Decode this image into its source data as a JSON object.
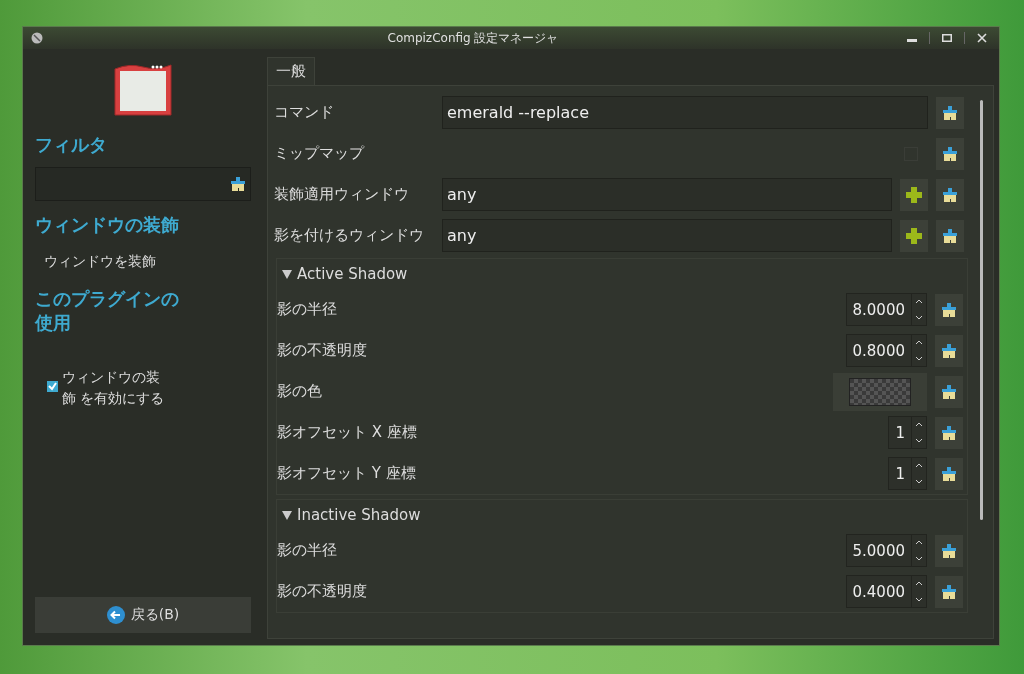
{
  "window": {
    "title": "CompizConfig 設定マネージャ"
  },
  "sidebar": {
    "filter_heading": "フィルタ",
    "plugin_heading": "ウィンドウの装飾",
    "plugin_description": "ウィンドウを装飾",
    "usage_heading": "このプラグインの使用",
    "enable": {
      "label": "ウィンドウの装飾 を有効にする",
      "checked": true
    },
    "back_button": "戻る(B)"
  },
  "tabs": [
    {
      "label": "一般",
      "selected": true
    }
  ],
  "options": [
    {
      "kind": "entry",
      "label": "コマンド",
      "value": "emerald --replace"
    },
    {
      "kind": "check",
      "label": "ミップマップ",
      "checked": false
    },
    {
      "kind": "list",
      "label": "装飾適用ウィンドウ",
      "value": "any"
    },
    {
      "kind": "list",
      "label": "影を付けるウィンドウ",
      "value": "any"
    },
    {
      "kind": "section",
      "label": "Active Shadow",
      "expanded": true,
      "children": [
        {
          "kind": "spin",
          "label": "影の半径",
          "value": "8.0000"
        },
        {
          "kind": "spin",
          "label": "影の不透明度",
          "value": "0.8000"
        },
        {
          "kind": "color",
          "label": "影の色"
        },
        {
          "kind": "spin",
          "label": "影オフセット X 座標",
          "value": "1"
        },
        {
          "kind": "spin",
          "label": "影オフセット Y 座標",
          "value": "1"
        }
      ]
    },
    {
      "kind": "section",
      "label": "Inactive Shadow",
      "expanded": true,
      "children": [
        {
          "kind": "spin",
          "label": "影の半径",
          "value": "5.0000"
        },
        {
          "kind": "spin",
          "label": "影の不透明度",
          "value": "0.4000"
        }
      ]
    }
  ]
}
